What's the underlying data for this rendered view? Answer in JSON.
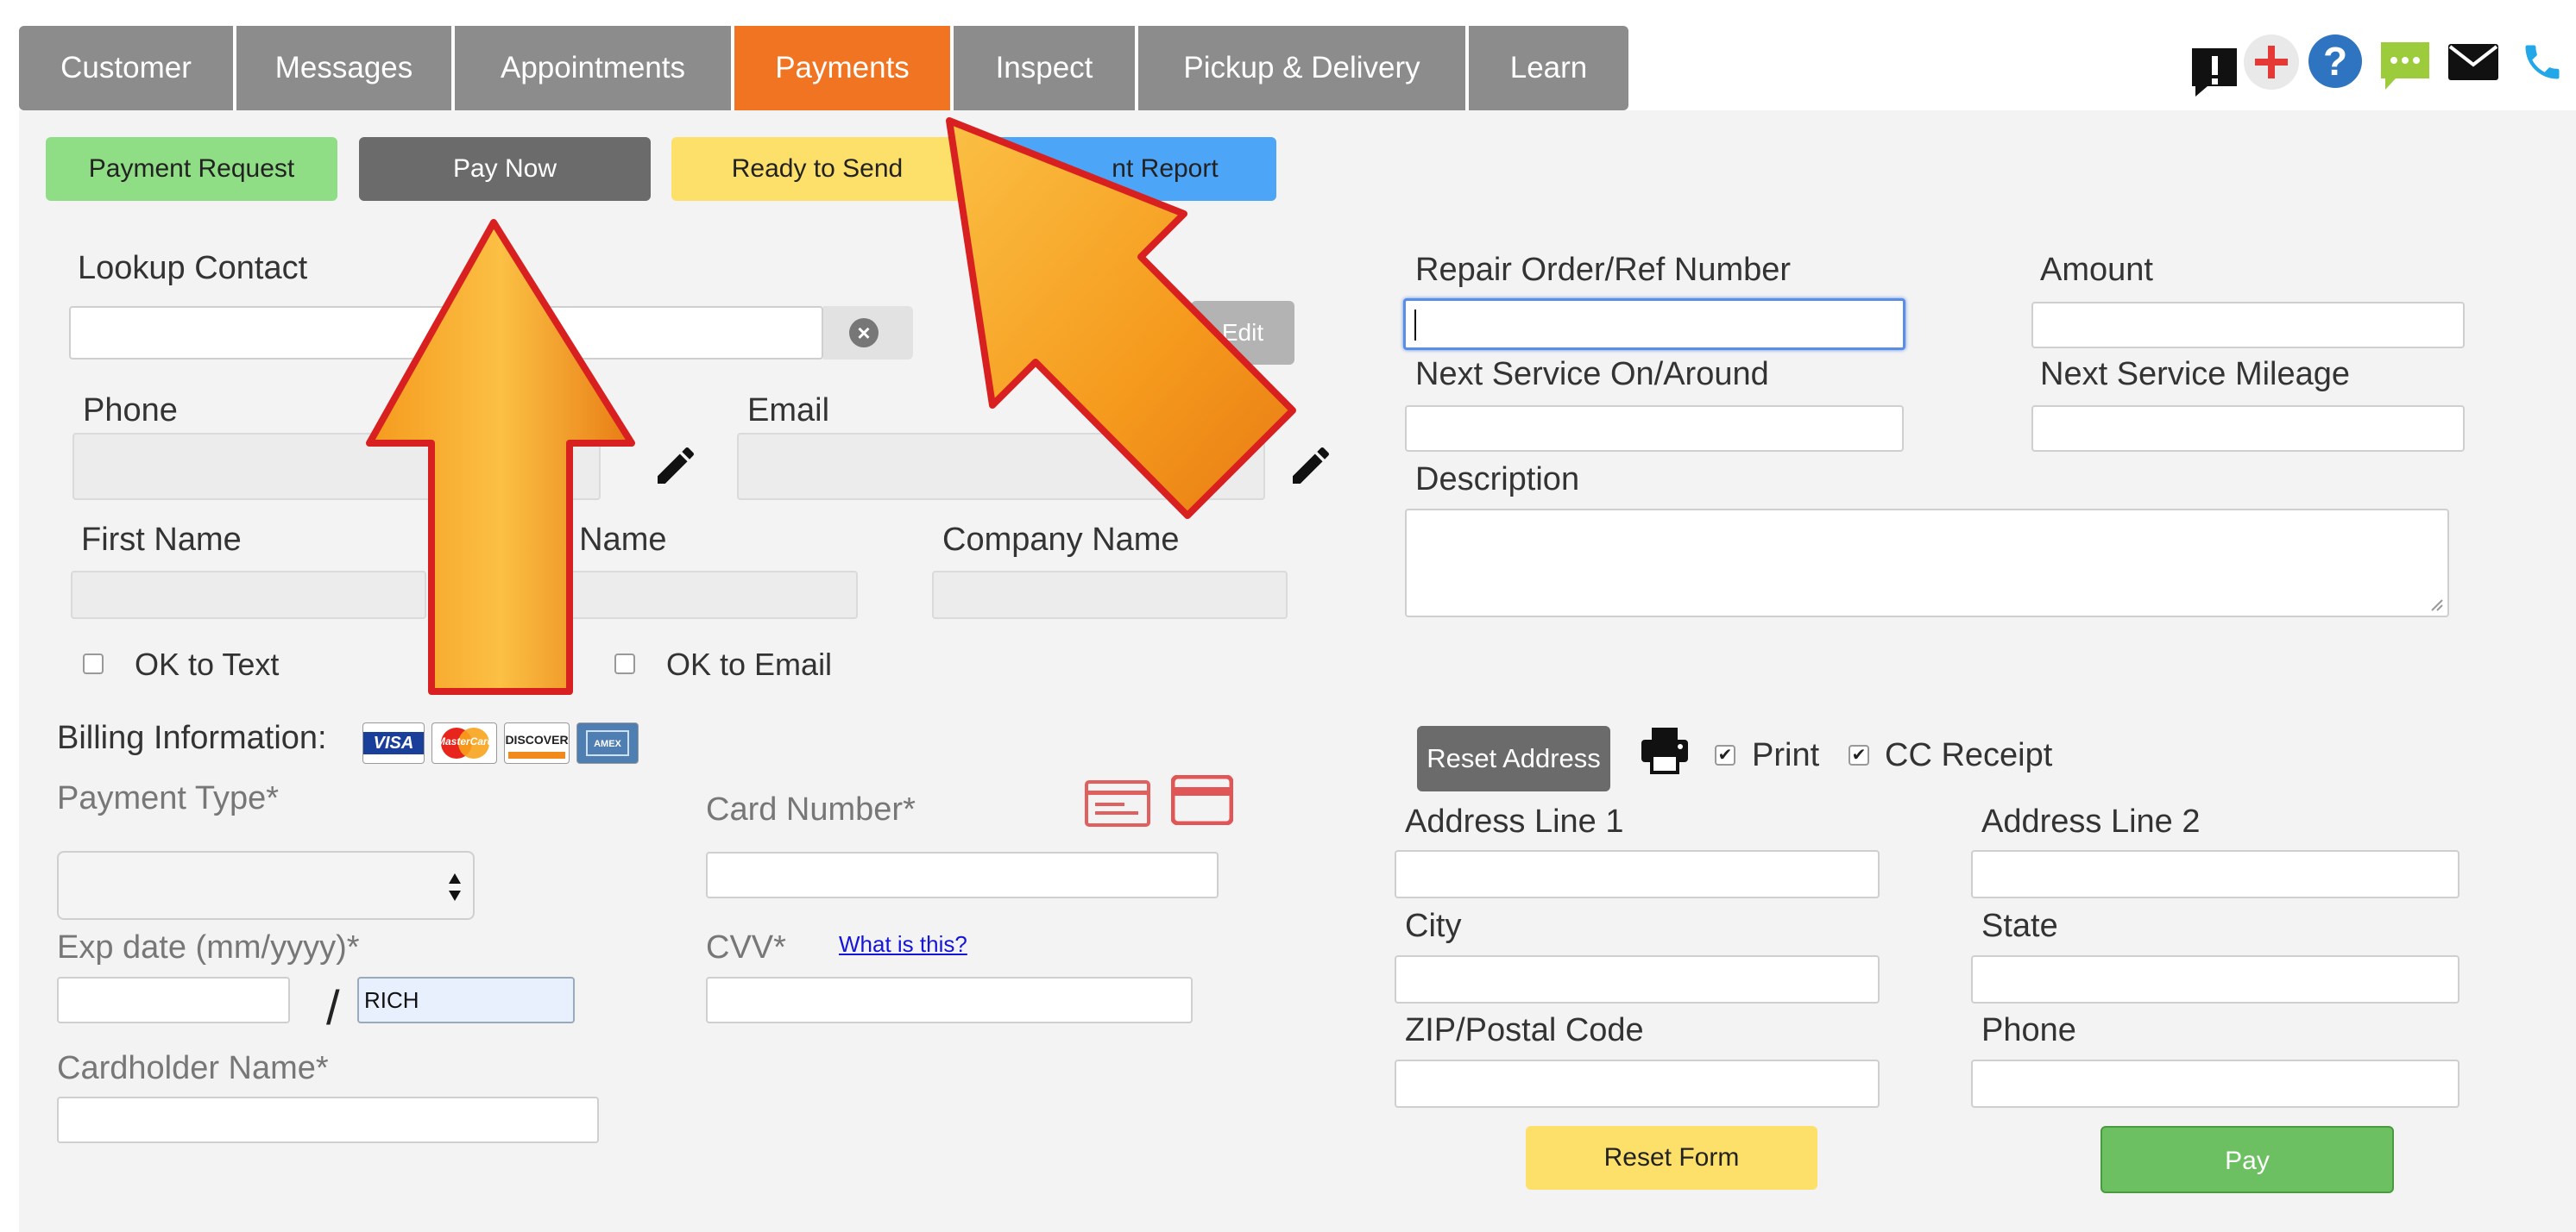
{
  "nav": {
    "tabs": [
      {
        "label": "Customer"
      },
      {
        "label": "Messages"
      },
      {
        "label": "Appointments"
      },
      {
        "label": "Payments",
        "active": true
      },
      {
        "label": "Inspect"
      },
      {
        "label": "Pickup & Delivery"
      },
      {
        "label": "Learn"
      }
    ],
    "icons": [
      "alert-icon",
      "plus-icon",
      "help-icon",
      "chat-icon",
      "mail-icon",
      "phone-icon"
    ]
  },
  "actions": {
    "payment_request": "Payment Request",
    "pay_now": "Pay Now",
    "ready_to_send": "Ready to Send",
    "payment_report_visible": "nt Report"
  },
  "contact": {
    "lookup_label": "Lookup Contact",
    "lookup_value": "",
    "edit_label": "Edit",
    "phone_label": "Phone",
    "email_label": "Email",
    "first_name_label": "First Name",
    "last_name_visible": "t Name",
    "company_label": "Company Name",
    "ok_text_label": "OK to Text",
    "ok_email_label": "OK to Email"
  },
  "order": {
    "ro_label": "Repair Order/Ref Number",
    "amount_label": "Amount",
    "next_service_label": "Next Service On/Around",
    "next_mileage_label": "Next Service Mileage",
    "description_label": "Description"
  },
  "billing": {
    "title": "Billing Information:",
    "cards": [
      "VISA",
      "MasterCard",
      "DISCOVER",
      "AMEX"
    ],
    "payment_type_label": "Payment Type*",
    "card_number_label": "Card Number*",
    "exp_label": "Exp date (mm/yyyy)*",
    "exp_sep": "/",
    "exp_year_value": "RICH",
    "cvv_label": "CVV*",
    "cvv_help": "What is this?",
    "cardholder_label": "Cardholder Name*"
  },
  "address": {
    "reset_address": "Reset Address",
    "print_label": "Print",
    "cc_receipt_label": "CC Receipt",
    "line1_label": "Address Line 1",
    "line2_label": "Address Line 2",
    "city_label": "City",
    "state_label": "State",
    "zip_label": "ZIP/Postal Code",
    "phone_label": "Phone",
    "reset_form": "Reset Form",
    "pay": "Pay"
  },
  "colors": {
    "active_tab": "#f07421",
    "payment_request": "#8fdd84",
    "pay_now": "#6b6b6b",
    "ready_to_send": "#fde06a",
    "payment_report": "#4da5f7",
    "pay_button": "#6cc061",
    "arrow_fill": "#f7a322",
    "arrow_stroke": "#d92020"
  }
}
